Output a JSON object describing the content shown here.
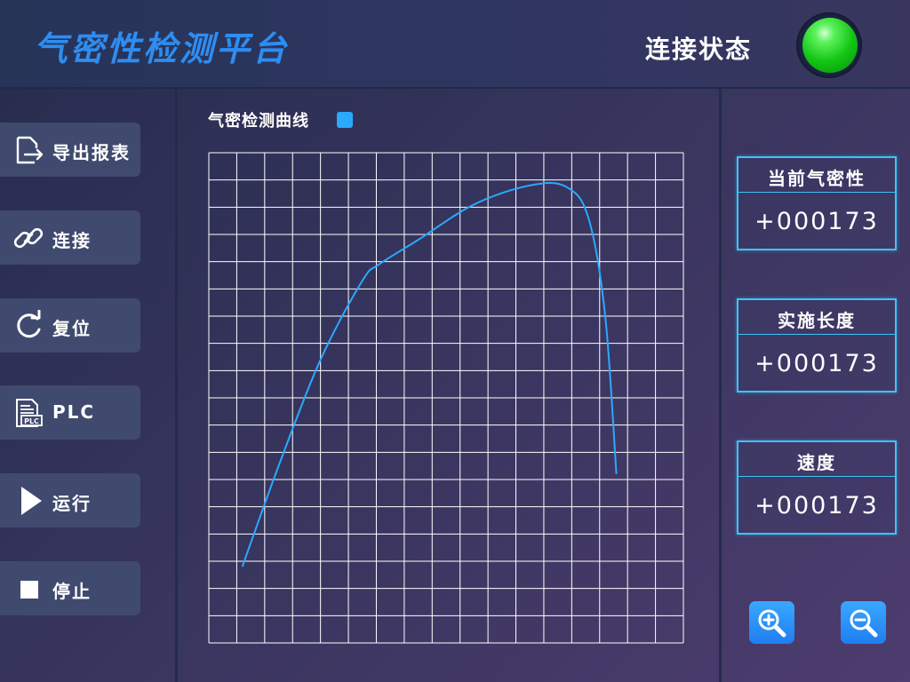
{
  "header": {
    "title": "气密性检测平台",
    "connection_label": "连接状态",
    "connection_status_color": "#22cc22"
  },
  "sidebar": {
    "buttons": [
      {
        "label": "导出报表",
        "icon": "export-file-icon"
      },
      {
        "label": "连接",
        "icon": "link-icon"
      },
      {
        "label": "复位",
        "icon": "reset-icon"
      },
      {
        "label": "PLC",
        "icon": "plc-document-icon"
      },
      {
        "label": "运行",
        "icon": "play-icon"
      },
      {
        "label": "停止",
        "icon": "stop-icon"
      }
    ]
  },
  "chart_section": {
    "title": "气密检测曲线",
    "legend_color": "#2ba9ff"
  },
  "chart_data": {
    "type": "line",
    "title": "气密检测曲线",
    "xlabel": "",
    "ylabel": "",
    "grid": true,
    "grid_divisions": {
      "x": 17,
      "y": 18
    },
    "xlim": [
      0,
      17
    ],
    "ylim": [
      0,
      18
    ],
    "series": [
      {
        "color": "#2ba9ff",
        "x": [
          1.2,
          2.5,
          4.0,
          5.5,
          6.1,
          7.5,
          9.5,
          11.5,
          12.8,
          13.6,
          14.2,
          14.6
        ],
        "y": [
          2.8,
          6.5,
          10.4,
          13.3,
          13.9,
          14.8,
          16.1,
          16.8,
          16.75,
          15.6,
          12.0,
          6.2
        ]
      }
    ]
  },
  "metrics": [
    {
      "label": "当前气密性",
      "value": "+000173"
    },
    {
      "label": "实施长度",
      "value": "+000173"
    },
    {
      "label": "速度",
      "value": "+000173"
    }
  ],
  "zoom": {
    "in_icon": "zoom-in-icon",
    "out_icon": "zoom-out-icon"
  }
}
